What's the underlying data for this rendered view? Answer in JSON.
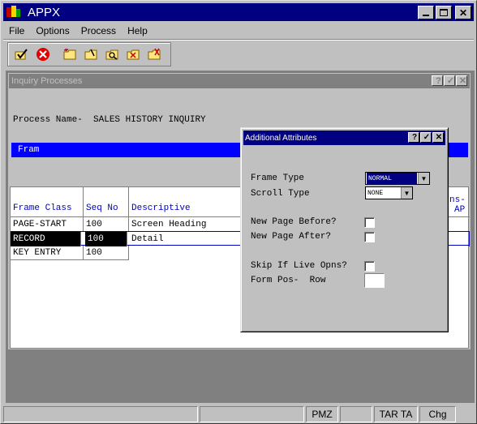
{
  "window": {
    "title": "APPX",
    "min_label": "_",
    "max_label": "□",
    "close_label": "✕"
  },
  "menu": [
    {
      "label": "File"
    },
    {
      "label": "Options"
    },
    {
      "label": "Process"
    },
    {
      "label": "Help"
    }
  ],
  "toolbar": {
    "icons": [
      "ok-check-icon",
      "cancel-icon",
      "add-folder-icon",
      "change-folder-icon",
      "inquire-folder-icon",
      "delete-folder-icon",
      "scan-folder-icon"
    ]
  },
  "inquiry": {
    "title": "Inquiry Processes",
    "help_label": "?",
    "ok_label": "✓",
    "close_label": "✕",
    "process_name_label": "Process Name-",
    "process_name_value": "SALES HISTORY INQUIRY",
    "frame_bar_text": "Fram",
    "columns": [
      "Frame Class",
      "Seq No",
      "Descriptive",
      "ns-",
      "AP"
    ],
    "rows": [
      {
        "frame_class": "PAGE-START",
        "seq_no": "100",
        "descriptive": "Screen Heading"
      },
      {
        "frame_class": "RECORD",
        "seq_no": "100",
        "descriptive": "Detail"
      },
      {
        "frame_class": "KEY ENTRY",
        "seq_no": "100",
        "descriptive": ""
      }
    ]
  },
  "dialog": {
    "title": "Additional Attributes",
    "help_label": "?",
    "ok_label": "✓",
    "close_label": "✕",
    "frame_type_label": "Frame Type",
    "frame_type_value": "NORMAL",
    "scroll_type_label": "Scroll Type",
    "scroll_type_value": "NONE",
    "new_page_before_label": "New Page Before?",
    "new_page_after_label": "New Page After?",
    "skip_if_live_label": "Skip If Live Opns?",
    "form_pos_label": "Form Pos-",
    "row_label": "Row"
  },
  "status": [
    "",
    "",
    "PMZ",
    "",
    "TAR TA",
    "Chg"
  ],
  "colors": {
    "title_blue": "#000080",
    "highlight_blue": "#0000ff",
    "face": "#c0c0c0"
  }
}
